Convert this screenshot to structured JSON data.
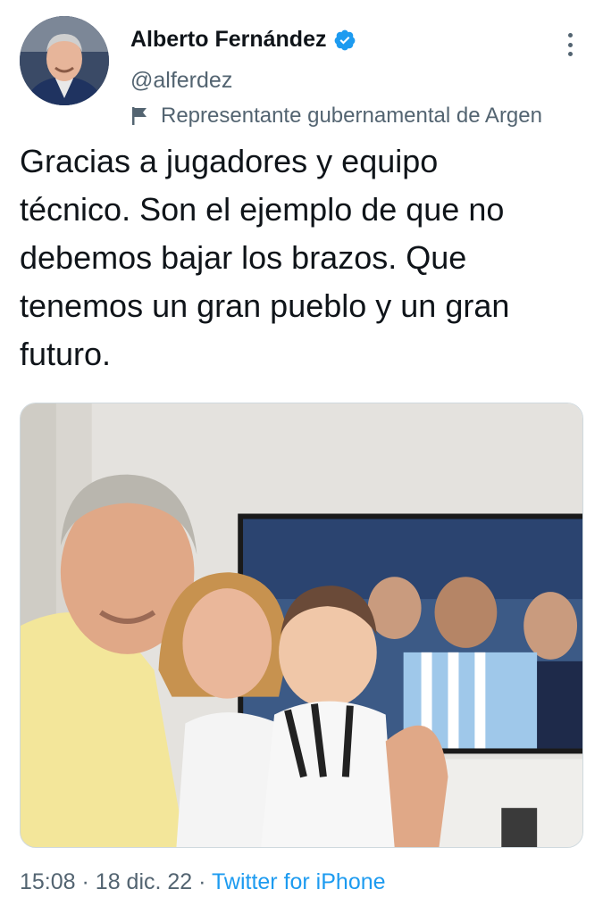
{
  "author": {
    "name": "Alberto Fernández",
    "handle": "@alferdez",
    "verified": true,
    "label": "Representante gubernamental de Argen"
  },
  "tweet": {
    "lines": [
      "Gracias a jugadores y equipo",
      "técnico. Son el ejemplo de que no",
      "debemos bajar los brazos. Que",
      "tenemos un gran pueblo y un gran",
      "futuro."
    ]
  },
  "meta": {
    "time": "15:08",
    "separator": "·",
    "date": "18 dic. 22",
    "source": "Twitter for iPhone"
  },
  "icons": {
    "verified": "verified-badge-icon",
    "more": "more-options-icon",
    "label": "government-flag-icon"
  },
  "colors": {
    "text": "#0f1419",
    "secondary": "#536471",
    "accent": "#1d9bf0"
  }
}
